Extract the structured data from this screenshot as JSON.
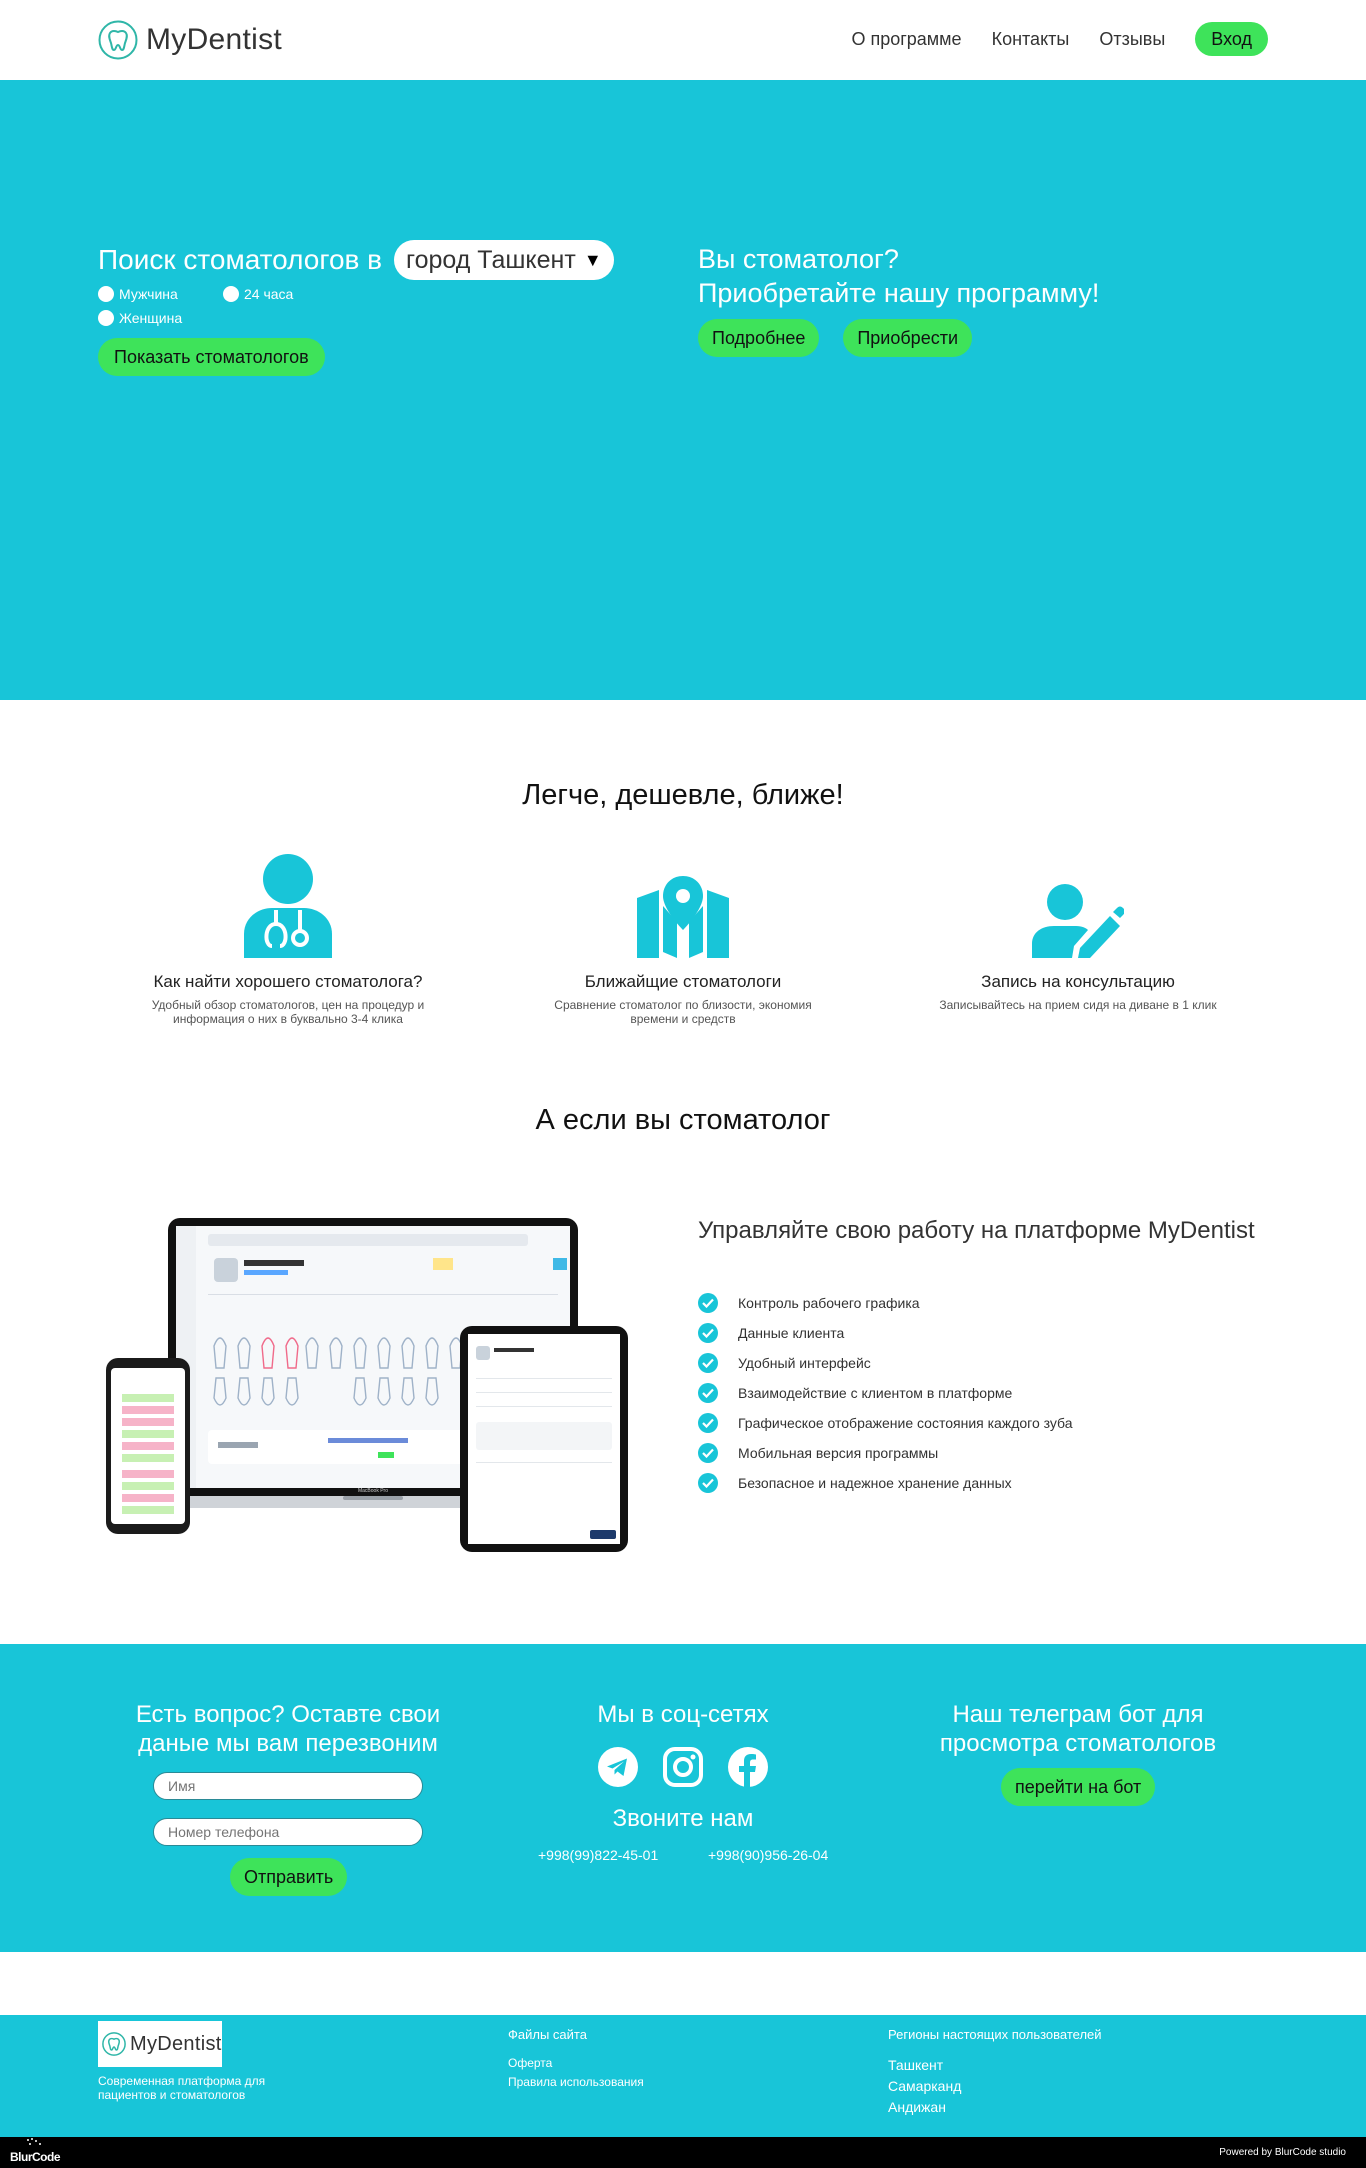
{
  "header": {
    "brand": "MyDentist",
    "nav": [
      "О программе",
      "Контакты",
      "Отзывы"
    ],
    "login": "Вход"
  },
  "hero": {
    "search_label": "Поиск стоматологов в",
    "city": "город Ташкент",
    "filters": {
      "male": "Мужчина",
      "female": "Женщина",
      "hours24": "24 часа"
    },
    "show_button": "Показать стоматологов",
    "promo_line1": "Вы стоматолог?",
    "promo_line2": "Приобретайте нашу программу!",
    "more_button": "Подробнее",
    "buy_button": "Приобрести"
  },
  "features": {
    "title": "Легче, дешевле, ближе!",
    "items": [
      {
        "icon": "doctor-icon",
        "title": "Как найти хорошего стоматолога?",
        "desc": "Удобный обзор стоматологов, цен на процедур и информация о них в буквально 3-4 клика"
      },
      {
        "icon": "map-pin-icon",
        "title": "Ближайщие стоматологи",
        "desc": "Сравнение стоматолог по близости, экономия времени и средств"
      },
      {
        "icon": "user-edit-icon",
        "title": "Запись на консультацию",
        "desc": "Записывайтесь на прием сидя на диване в 1 клик"
      }
    ]
  },
  "dentist": {
    "title": "А если вы стоматолог",
    "platform_title": "Управляйте свою работу на платформе MyDentist",
    "checklist": [
      "Контроль рабочего графика",
      "Данные клиента",
      "Удобный интерфейс",
      "Взаимодействие с клиентом в платформе",
      "Графическое отображение состояния каждого зуба",
      "Мобильная версия программы",
      "Безопасное и надежное хранение данных"
    ],
    "laptop_label": "MacBook Pro"
  },
  "contact": {
    "question_title": "Есть вопрос? Оставте свои даные мы вам перезвоним",
    "name_placeholder": "Имя",
    "phone_placeholder": "Номер телефона",
    "send_button": "Отправить",
    "social_title": "Мы в соц-сетях",
    "social_icons": [
      "telegram-icon",
      "instagram-icon",
      "facebook-icon"
    ],
    "call_title": "Звоните нам",
    "phones": [
      "+998(99)822-45-01",
      "+998(90)956-26-04"
    ],
    "bot_title": "Наш телеграм бот для просмотра стоматологов",
    "bot_button": "перейти на бот"
  },
  "footer": {
    "brand": "MyDentist",
    "description": "Современная платформа для пациентов и стоматологов",
    "files_title": "Файлы сайта",
    "files": [
      "Оферта",
      "Правила использования"
    ],
    "regions_title": "Регионы настоящих пользователей",
    "regions": [
      "Ташкент",
      "Самарканд",
      "Андижан"
    ],
    "studio_logo": "BlurCode",
    "powered": "Powered by BlurCode studio"
  },
  "colors": {
    "accent": "#18c5d8",
    "button": "#3ee35a",
    "bottom_bar": "#000000"
  }
}
